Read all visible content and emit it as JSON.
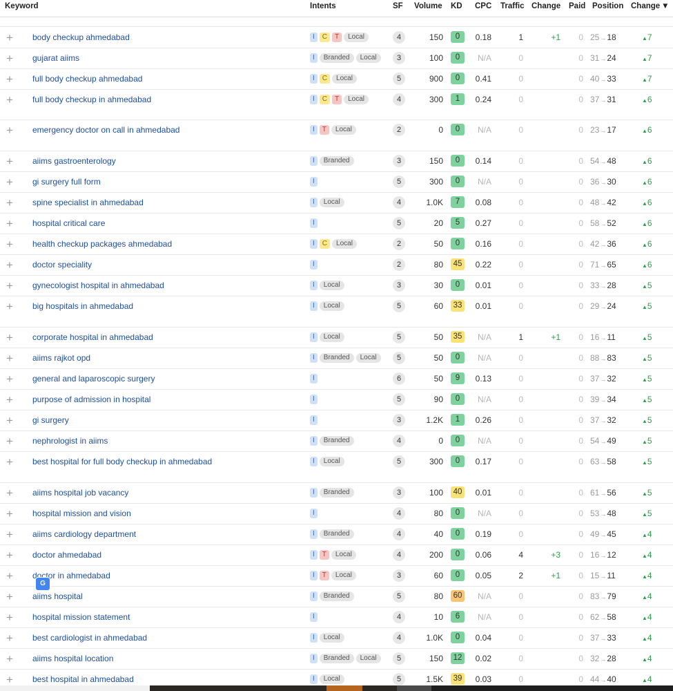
{
  "headers": {
    "keyword": "Keyword",
    "intents": "Intents",
    "sf": "SF",
    "volume": "Volume",
    "kd": "KD",
    "cpc": "CPC",
    "traffic": "Traffic",
    "change": "Change",
    "paid": "Paid",
    "position": "Position",
    "position_change": "Change",
    "sort_icon": "caret-down-icon"
  },
  "icons": {
    "add_row": "plus-icon",
    "translate": "google-translate-icon",
    "position_arrow": "arrow-right-icon",
    "position_up": "triangle-up-icon"
  },
  "colors": {
    "keyword_link": "#1d4fa3",
    "positive": "#2e9e4a",
    "kd_green": "#7ed29d",
    "kd_light_green": "#b0e0a6",
    "kd_yellow": "#fae276",
    "kd_orange": "#fbc375"
  },
  "rows": [
    {
      "keyword": "body checkup ahmedabad",
      "intents": [
        "I",
        "C",
        "T",
        "Local"
      ],
      "sf": "4",
      "volume": "150",
      "kd": "0",
      "cpc": "0.18",
      "traffic": "1",
      "change": "+1",
      "paid": "0",
      "pos_from": "25",
      "pos_to": "18",
      "pos_change": "7"
    },
    {
      "keyword": "gujarat aiims",
      "intents": [
        "I",
        "Branded",
        "Local"
      ],
      "sf": "3",
      "volume": "100",
      "kd": "0",
      "cpc": "N/A",
      "traffic": "0",
      "change": "",
      "paid": "0",
      "pos_from": "31",
      "pos_to": "24",
      "pos_change": "7"
    },
    {
      "keyword": "full body checkup ahmedabad",
      "intents": [
        "I",
        "C",
        "Local"
      ],
      "sf": "5",
      "volume": "900",
      "kd": "0",
      "cpc": "0.41",
      "traffic": "0",
      "change": "",
      "paid": "0",
      "pos_from": "40",
      "pos_to": "33",
      "pos_change": "7"
    },
    {
      "keyword": "full body checkup in ahmedabad",
      "intents": [
        "I",
        "C",
        "T",
        "Local"
      ],
      "sf": "4",
      "volume": "300",
      "kd": "1",
      "cpc": "0.24",
      "traffic": "0",
      "change": "",
      "paid": "0",
      "pos_from": "37",
      "pos_to": "31",
      "pos_change": "6"
    },
    {
      "keyword": "emergency doctor on call in ahmedabad",
      "intents": [
        "I",
        "T",
        "Local"
      ],
      "sf": "2",
      "volume": "0",
      "kd": "0",
      "cpc": "N/A",
      "traffic": "0",
      "change": "",
      "paid": "0",
      "pos_from": "23",
      "pos_to": "17",
      "pos_change": "6"
    },
    {
      "keyword": "aiims gastroenterology",
      "intents": [
        "I",
        "Branded"
      ],
      "sf": "3",
      "volume": "150",
      "kd": "0",
      "cpc": "0.14",
      "traffic": "0",
      "change": "",
      "paid": "0",
      "pos_from": "54",
      "pos_to": "48",
      "pos_change": "6"
    },
    {
      "keyword": "gi surgery full form",
      "intents": [
        "I"
      ],
      "sf": "5",
      "volume": "300",
      "kd": "0",
      "cpc": "N/A",
      "traffic": "0",
      "change": "",
      "paid": "0",
      "pos_from": "36",
      "pos_to": "30",
      "pos_change": "6"
    },
    {
      "keyword": "spine specialist in ahmedabad",
      "intents": [
        "I",
        "Local"
      ],
      "sf": "4",
      "volume": "1.0K",
      "kd": "7",
      "cpc": "0.08",
      "traffic": "0",
      "change": "",
      "paid": "0",
      "pos_from": "48",
      "pos_to": "42",
      "pos_change": "6"
    },
    {
      "keyword": "hospital critical care",
      "intents": [
        "I"
      ],
      "sf": "5",
      "volume": "20",
      "kd": "5",
      "cpc": "0.27",
      "traffic": "0",
      "change": "",
      "paid": "0",
      "pos_from": "58",
      "pos_to": "52",
      "pos_change": "6"
    },
    {
      "keyword": "health checkup packages ahmedabad",
      "intents": [
        "I",
        "C",
        "Local"
      ],
      "sf": "2",
      "volume": "50",
      "kd": "0",
      "cpc": "0.16",
      "traffic": "0",
      "change": "",
      "paid": "0",
      "pos_from": "42",
      "pos_to": "36",
      "pos_change": "6"
    },
    {
      "keyword": "doctor speciality",
      "intents": [
        "I"
      ],
      "sf": "2",
      "volume": "80",
      "kd": "45",
      "cpc": "0.22",
      "traffic": "0",
      "change": "",
      "paid": "0",
      "pos_from": "71",
      "pos_to": "65",
      "pos_change": "6"
    },
    {
      "keyword": "gynecologist hospital in ahmedabad",
      "intents": [
        "I",
        "Local"
      ],
      "sf": "3",
      "volume": "30",
      "kd": "0",
      "cpc": "0.01",
      "traffic": "0",
      "change": "",
      "paid": "0",
      "pos_from": "33",
      "pos_to": "28",
      "pos_change": "5"
    },
    {
      "keyword": "big hospitals in ahmedabad",
      "intents": [
        "I",
        "Local"
      ],
      "sf": "5",
      "volume": "60",
      "kd": "33",
      "cpc": "0.01",
      "traffic": "0",
      "change": "",
      "paid": "0",
      "pos_from": "29",
      "pos_to": "24",
      "pos_change": "5"
    },
    {
      "keyword": "corporate hospital in ahmedabad",
      "intents": [
        "I",
        "Local"
      ],
      "sf": "5",
      "volume": "50",
      "kd": "35",
      "cpc": "N/A",
      "traffic": "1",
      "change": "+1",
      "paid": "0",
      "pos_from": "16",
      "pos_to": "11",
      "pos_change": "5"
    },
    {
      "keyword": "aiims rajkot opd",
      "intents": [
        "I",
        "Branded",
        "Local"
      ],
      "sf": "5",
      "volume": "50",
      "kd": "0",
      "cpc": "N/A",
      "traffic": "0",
      "change": "",
      "paid": "0",
      "pos_from": "88",
      "pos_to": "83",
      "pos_change": "5"
    },
    {
      "keyword": "general and laparoscopic surgery",
      "intents": [
        "I"
      ],
      "sf": "6",
      "volume": "50",
      "kd": "9",
      "cpc": "0.13",
      "traffic": "0",
      "change": "",
      "paid": "0",
      "pos_from": "37",
      "pos_to": "32",
      "pos_change": "5"
    },
    {
      "keyword": "purpose of admission in hospital",
      "intents": [
        "I"
      ],
      "sf": "5",
      "volume": "90",
      "kd": "0",
      "cpc": "N/A",
      "traffic": "0",
      "change": "",
      "paid": "0",
      "pos_from": "39",
      "pos_to": "34",
      "pos_change": "5"
    },
    {
      "keyword": "gi surgery",
      "intents": [
        "I"
      ],
      "sf": "3",
      "volume": "1.2K",
      "kd": "1",
      "cpc": "0.26",
      "traffic": "0",
      "change": "",
      "paid": "0",
      "pos_from": "37",
      "pos_to": "32",
      "pos_change": "5"
    },
    {
      "keyword": "nephrologist in aiims",
      "intents": [
        "I",
        "Branded"
      ],
      "sf": "4",
      "volume": "0",
      "kd": "0",
      "cpc": "N/A",
      "traffic": "0",
      "change": "",
      "paid": "0",
      "pos_from": "54",
      "pos_to": "49",
      "pos_change": "5"
    },
    {
      "keyword": "best hospital for full body checkup in ahmedabad",
      "intents": [
        "I",
        "Local"
      ],
      "sf": "5",
      "volume": "300",
      "kd": "0",
      "cpc": "0.17",
      "traffic": "0",
      "change": "",
      "paid": "0",
      "pos_from": "63",
      "pos_to": "58",
      "pos_change": "5"
    },
    {
      "keyword": "aiims hospital job vacancy",
      "intents": [
        "I",
        "Branded"
      ],
      "sf": "3",
      "volume": "100",
      "kd": "40",
      "cpc": "0.01",
      "traffic": "0",
      "change": "",
      "paid": "0",
      "pos_from": "61",
      "pos_to": "56",
      "pos_change": "5"
    },
    {
      "keyword": "hospital mission and vision",
      "intents": [
        "I"
      ],
      "sf": "4",
      "volume": "80",
      "kd": "0",
      "cpc": "N/A",
      "traffic": "0",
      "change": "",
      "paid": "0",
      "pos_from": "53",
      "pos_to": "48",
      "pos_change": "5"
    },
    {
      "keyword": "aiims cardiology department",
      "intents": [
        "I",
        "Branded"
      ],
      "sf": "4",
      "volume": "40",
      "kd": "0",
      "cpc": "0.19",
      "traffic": "0",
      "change": "",
      "paid": "0",
      "pos_from": "49",
      "pos_to": "45",
      "pos_change": "4"
    },
    {
      "keyword": "doctor ahmedabad",
      "intents": [
        "I",
        "T",
        "Local"
      ],
      "sf": "4",
      "volume": "200",
      "kd": "0",
      "cpc": "0.06",
      "traffic": "4",
      "change": "+3",
      "paid": "0",
      "pos_from": "16",
      "pos_to": "12",
      "pos_change": "4"
    },
    {
      "keyword": "doctor in ahmedabad",
      "intents": [
        "I",
        "T",
        "Local"
      ],
      "sf": "3",
      "volume": "60",
      "kd": "0",
      "cpc": "0.05",
      "traffic": "2",
      "change": "+1",
      "paid": "0",
      "pos_from": "15",
      "pos_to": "11",
      "pos_change": "4"
    },
    {
      "keyword": "aiims hospital",
      "intents": [
        "I",
        "Branded"
      ],
      "sf": "5",
      "volume": "80",
      "kd": "60",
      "cpc": "N/A",
      "traffic": "0",
      "change": "",
      "paid": "0",
      "pos_from": "83",
      "pos_to": "79",
      "pos_change": "4"
    },
    {
      "keyword": "hospital mission statement",
      "intents": [
        "I"
      ],
      "sf": "4",
      "volume": "10",
      "kd": "6",
      "cpc": "N/A",
      "traffic": "0",
      "change": "",
      "paid": "0",
      "pos_from": "62",
      "pos_to": "58",
      "pos_change": "4"
    },
    {
      "keyword": "best cardiologist in ahmedabad",
      "intents": [
        "I",
        "Local"
      ],
      "sf": "4",
      "volume": "1.0K",
      "kd": "0",
      "cpc": "0.04",
      "traffic": "0",
      "change": "",
      "paid": "0",
      "pos_from": "37",
      "pos_to": "33",
      "pos_change": "4"
    },
    {
      "keyword": "aiims hospital location",
      "intents": [
        "I",
        "Branded",
        "Local"
      ],
      "sf": "5",
      "volume": "150",
      "kd": "12",
      "cpc": "0.02",
      "traffic": "0",
      "change": "",
      "paid": "0",
      "pos_from": "32",
      "pos_to": "28",
      "pos_change": "4"
    },
    {
      "keyword": "best hospital in ahmedabad",
      "intents": [
        "I",
        "Local"
      ],
      "sf": "5",
      "volume": "1.5K",
      "kd": "39",
      "cpc": "0.03",
      "traffic": "0",
      "change": "",
      "paid": "0",
      "pos_from": "44",
      "pos_to": "40",
      "pos_change": "4"
    }
  ]
}
